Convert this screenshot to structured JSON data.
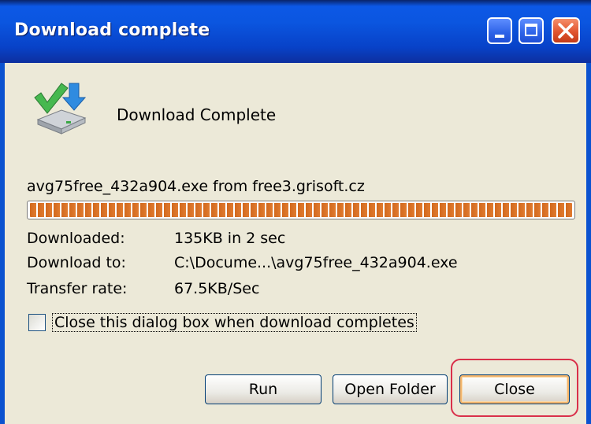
{
  "window": {
    "title": "Download complete",
    "controls": [
      "minimize-icon",
      "maximize-icon",
      "close-icon"
    ]
  },
  "dialog": {
    "heading": "Download Complete",
    "source": "avg75free_432a904.exe from free3.grisoft.cz",
    "progress_percent": 100,
    "fields": {
      "downloaded_label": "Downloaded:",
      "downloaded_value": "135KB in 2 sec",
      "download_to_label": "Download to:",
      "download_to_value": "C:\\Docume...\\avg75free_432a904.exe",
      "transfer_rate_label": "Transfer rate:",
      "transfer_rate_value": "67.5KB/Sec"
    },
    "checkbox": {
      "label": "Close this dialog box when download completes",
      "checked": false
    },
    "buttons": {
      "run": "Run",
      "open_folder": "Open Folder",
      "close": "Close"
    }
  },
  "colors": {
    "titlebar": "#0b56e0",
    "client_bg": "#ece9d8",
    "progress": "#d2691e",
    "highlight": "#d9304a"
  }
}
